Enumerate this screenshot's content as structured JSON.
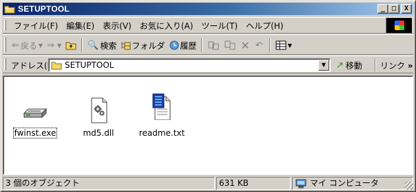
{
  "window": {
    "title": "SETUPTOOL",
    "controls": {
      "minimize": "_",
      "maximize": "□",
      "close": "X"
    }
  },
  "menu": {
    "items": [
      "ファイル(F)",
      "編集(E)",
      "表示(V)",
      "お気に入り(A)",
      "ツール(T)",
      "ヘルプ(H)"
    ]
  },
  "toolbar": {
    "back": "戻る",
    "search": "検索",
    "folders": "フォルダ",
    "history": "履歴"
  },
  "address": {
    "label": "アドレス(D)",
    "value": "SETUPTOOL",
    "go": "移動",
    "links": "リンク"
  },
  "files": [
    {
      "name": "fwinst.exe",
      "icon": "exe-device-icon"
    },
    {
      "name": "md5.dll",
      "icon": "dll-gear-icon"
    },
    {
      "name": "readme.txt",
      "icon": "txt-document-icon"
    }
  ],
  "status": {
    "objects": "3 個のオブジェクト",
    "size": "631 KB",
    "zone": "マイ コンピュータ"
  },
  "colors": {
    "title_start": "#0a246a",
    "title_end": "#a6caf0",
    "face": "#d4d0c8"
  }
}
